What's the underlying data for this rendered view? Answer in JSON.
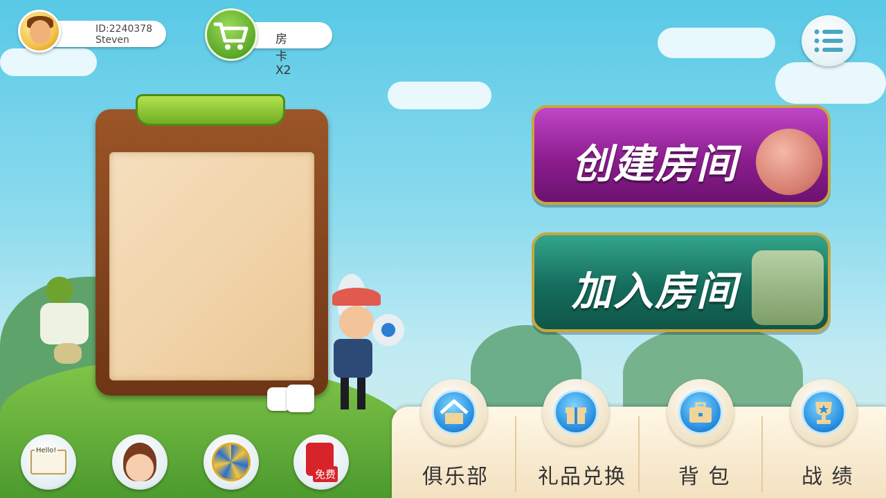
{
  "user": {
    "id_text": "ID:2240378",
    "name": "Steven"
  },
  "shop": {
    "room_cards": "房卡X2"
  },
  "main_buttons": {
    "create_room": "创建房间",
    "join_room": "加入房间"
  },
  "bottom_nav": [
    {
      "label": "俱乐部",
      "icon": "house-icon"
    },
    {
      "label": "礼品兑换",
      "icon": "gift-icon"
    },
    {
      "label": "背 包",
      "icon": "briefcase-icon"
    },
    {
      "label": "战 绩",
      "icon": "trophy-icon"
    }
  ],
  "left_buttons": [
    {
      "name": "mail",
      "icon": "envelope-icon",
      "text": "Hello!"
    },
    {
      "name": "customer-service",
      "icon": "girl-avatar-icon"
    },
    {
      "name": "lucky-wheel",
      "icon": "wheel-icon"
    },
    {
      "name": "free",
      "icon": "red-packet-icon",
      "text": "免费"
    }
  ],
  "colors": {
    "create_button": "#8c1d8e",
    "join_button": "#156c5c",
    "cart_button": "#5aa82a",
    "nav_icon": "#2a8fe0"
  }
}
